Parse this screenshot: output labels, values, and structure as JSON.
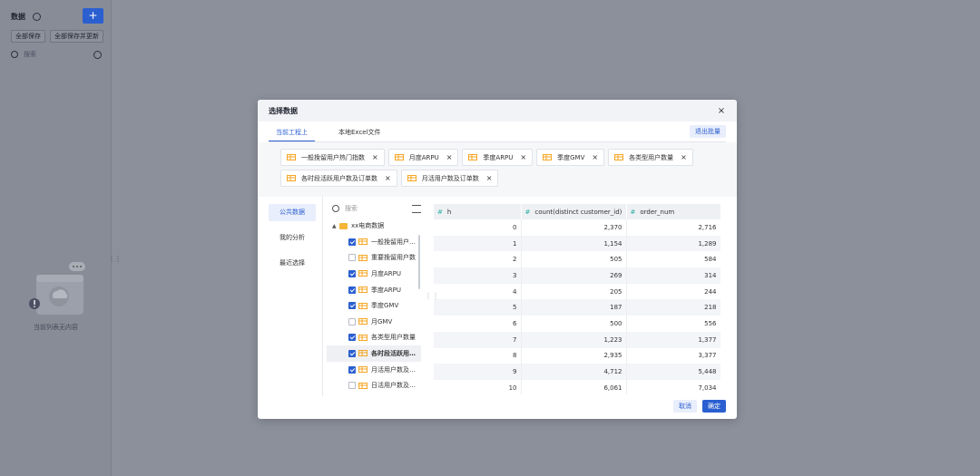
{
  "sidebar": {
    "title": "数据",
    "add_label": "+",
    "save_all_label": "全部保存",
    "save_all_update_label": "全部保存并更新",
    "search_placeholder": "搜索",
    "empty_text": "当前列表无内容"
  },
  "modal": {
    "title": "选择数据",
    "close_label": "×",
    "tabs": [
      {
        "label": "当前工程上",
        "active": true
      },
      {
        "label": "本地Excel文件",
        "active": false
      }
    ],
    "exit_batch_label": "退出批量",
    "chips": [
      {
        "label": "一般挽留用户热门指数"
      },
      {
        "label": "月度ARPU"
      },
      {
        "label": "季度ARPU"
      },
      {
        "label": "季度GMV"
      },
      {
        "label": "各类型用户数量"
      },
      {
        "label": "各时段活跃用户数及订单数"
      },
      {
        "label": "月活用户数及订单数"
      }
    ],
    "chip_remove_label": "×",
    "nav": [
      {
        "label": "公共数据",
        "active": true
      },
      {
        "label": "我的分析",
        "active": false
      },
      {
        "label": "最近选择",
        "active": false
      }
    ],
    "tree": {
      "search_placeholder": "搜索",
      "root_label": "xx电商数据",
      "items": [
        {
          "label": "一般挽留用户热门指数",
          "checked": true,
          "highlight": false
        },
        {
          "label": "重要挽留用户数",
          "checked": false,
          "highlight": false
        },
        {
          "label": "月度ARPU",
          "checked": true,
          "highlight": false
        },
        {
          "label": "季度ARPU",
          "checked": true,
          "highlight": false
        },
        {
          "label": "季度GMV",
          "checked": true,
          "highlight": false
        },
        {
          "label": "月GMV",
          "checked": false,
          "highlight": false
        },
        {
          "label": "各类型用户数量",
          "checked": true,
          "highlight": false
        },
        {
          "label": "各时段活跃用户数及订单数",
          "checked": true,
          "highlight": true
        },
        {
          "label": "月活用户数及订单数",
          "checked": true,
          "highlight": false
        },
        {
          "label": "日活用户数及订单数",
          "checked": false,
          "highlight": false
        }
      ]
    },
    "table": {
      "columns": [
        "h",
        "count(distinct customer_id)",
        "order_num"
      ],
      "column_type_icon": "#",
      "rows": [
        [
          "0",
          "2,370",
          "2,716"
        ],
        [
          "1",
          "1,154",
          "1,289"
        ],
        [
          "2",
          "505",
          "584"
        ],
        [
          "3",
          "269",
          "314"
        ],
        [
          "4",
          "205",
          "244"
        ],
        [
          "5",
          "187",
          "218"
        ],
        [
          "6",
          "500",
          "556"
        ],
        [
          "7",
          "1,223",
          "1,377"
        ],
        [
          "8",
          "2,935",
          "3,377"
        ],
        [
          "9",
          "4,712",
          "5,448"
        ],
        [
          "10",
          "6,061",
          "7,034"
        ]
      ]
    },
    "cancel_label": "取消",
    "ok_label": "确定"
  },
  "colors": {
    "accent": "#2b5fd0",
    "overlay": "#8b909b",
    "table_icon": "#f5b638"
  },
  "icons": [
    "settings-icon",
    "search-icon",
    "more-icon",
    "close-icon",
    "table-icon",
    "folder-icon",
    "sort-icon",
    "checkbox-icon"
  ]
}
